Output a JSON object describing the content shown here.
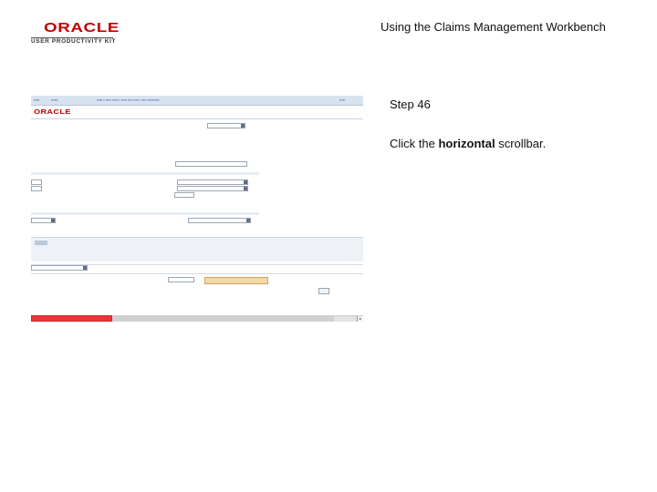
{
  "logo": {
    "brand": "ORACLE",
    "product": "USER PRODUCTIVITY KIT"
  },
  "doc_title": "Using the Claims Management Workbench",
  "step": {
    "number_label": "Step 46",
    "instruction_prefix": "Click the ",
    "instruction_emphasis": "horizontal",
    "instruction_suffix": " scrollbar."
  },
  "target_control": "horizontal-scrollbar",
  "highlight_color": "#e02020",
  "icons": {
    "scroll_right": "chevron-right-icon"
  }
}
